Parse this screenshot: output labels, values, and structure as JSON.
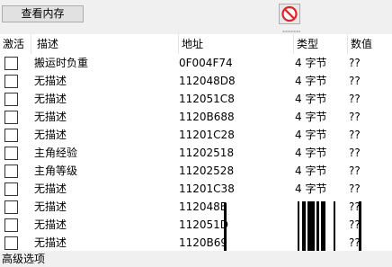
{
  "toolbar": {
    "view_memory_label": "查看内存",
    "stop_icon": "no-entry-icon",
    "stop_color": "#e0242b"
  },
  "table": {
    "columns": [
      "激活",
      "描述",
      "地址",
      "类型",
      "数值"
    ],
    "rows": [
      {
        "description": "搬运时负重",
        "address": "0F004F74",
        "type": "4 字节",
        "value": "??"
      },
      {
        "description": "无描述",
        "address": "112048D8",
        "type": "4 字节",
        "value": "??"
      },
      {
        "description": "无描述",
        "address": "112051C8",
        "type": "4 字节",
        "value": "??"
      },
      {
        "description": "无描述",
        "address": "1120B688",
        "type": "4 字节",
        "value": "??"
      },
      {
        "description": "无描述",
        "address": "11201C28",
        "type": "4 字节",
        "value": "??"
      },
      {
        "description": "主角经验",
        "address": "11202518",
        "type": "4 字节",
        "value": "??"
      },
      {
        "description": "主角等级",
        "address": "11202528",
        "type": "4 字节",
        "value": "??"
      },
      {
        "description": "无描述",
        "address": "11201C38",
        "type": "4 字节",
        "value": "??"
      },
      {
        "description": "无描述",
        "address": "112048E",
        "type": "",
        "value": "??"
      },
      {
        "description": "无描述",
        "address": "112051D",
        "type": "",
        "value": "??"
      },
      {
        "description": "无描述",
        "address": "1120B69",
        "type": "",
        "value": "??"
      }
    ]
  },
  "status": {
    "advanced_options_label": "高级选项"
  }
}
